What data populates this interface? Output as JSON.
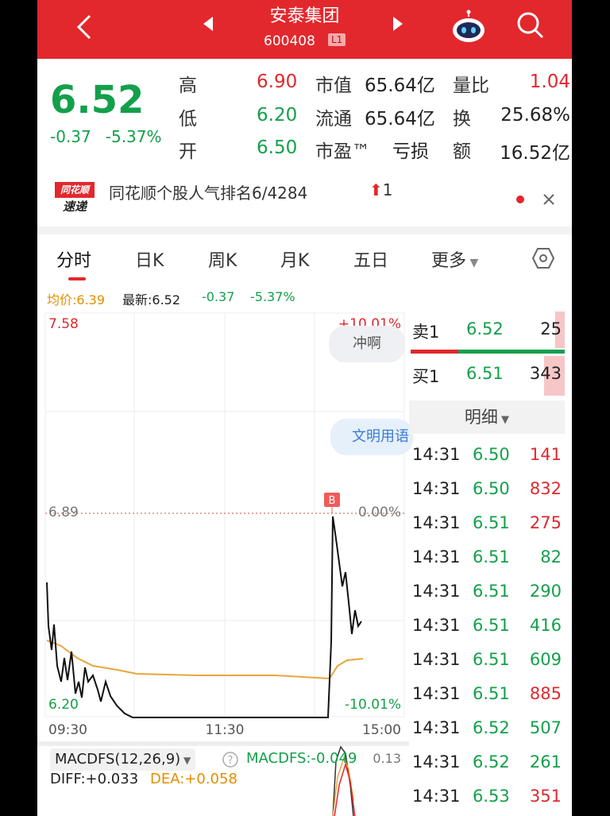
{
  "header": {
    "title": "安泰集团",
    "code": "600408",
    "level_badge": "L1",
    "colors": {
      "bar": "#e2282d"
    }
  },
  "quote": {
    "price": "6.52",
    "change": "-0.37",
    "change_pct": "-5.37%",
    "rows": [
      {
        "l1": "高",
        "v1": "6.90",
        "l2": "市值",
        "v2": "65.64亿",
        "l3": "量比",
        "v3": "1.04"
      },
      {
        "l1": "低",
        "v1": "6.20",
        "l2": "流通",
        "v2": "65.64亿",
        "l3": "换",
        "v3": "25.68%"
      },
      {
        "l1": "开",
        "v1": "6.50",
        "l2": "市盈™",
        "v2": "亏损",
        "l3": "额",
        "v3": "16.52亿"
      }
    ]
  },
  "news": {
    "logo_top": "同花顺",
    "logo_bottom": "速递",
    "text": "同花顺个股人气排名6/4284",
    "rank_change": "1"
  },
  "tabs": [
    "分时",
    "日K",
    "周K",
    "月K",
    "五日",
    "更多"
  ],
  "info": {
    "avg_label": "均价:6.39",
    "latest_label": "最新:6.52",
    "change": "-0.37",
    "change_pct": "-5.37%"
  },
  "chart": {
    "top_price": "7.58",
    "mid_price": "6.89",
    "bottom_price": "6.20",
    "top_pct": "+10.01%",
    "mid_pct": "0.00%",
    "bottom_pct": "-10.01%",
    "time_labels": [
      "09:30",
      "11:30",
      "15:00"
    ],
    "marker": "B",
    "pill_1": "冲啊",
    "pill_2": "文明用语"
  },
  "order_book": {
    "sell": {
      "label": "卖1",
      "price": "6.52",
      "volume": "25"
    },
    "buy": {
      "label": "买1",
      "price": "6.51",
      "volume": "343"
    },
    "detail_label": "明细"
  },
  "ticks": [
    {
      "time": "14:31",
      "price": "6.50",
      "vol": "141",
      "side": "red"
    },
    {
      "time": "14:31",
      "price": "6.50",
      "vol": "832",
      "side": "red"
    },
    {
      "time": "14:31",
      "price": "6.51",
      "vol": "275",
      "side": "red"
    },
    {
      "time": "14:31",
      "price": "6.51",
      "vol": "82",
      "side": "green"
    },
    {
      "time": "14:31",
      "price": "6.51",
      "vol": "290",
      "side": "green"
    },
    {
      "time": "14:31",
      "price": "6.51",
      "vol": "416",
      "side": "green"
    },
    {
      "time": "14:31",
      "price": "6.51",
      "vol": "609",
      "side": "green"
    },
    {
      "time": "14:31",
      "price": "6.51",
      "vol": "885",
      "side": "red"
    },
    {
      "time": "14:31",
      "price": "6.52",
      "vol": "507",
      "side": "green"
    },
    {
      "time": "14:31",
      "price": "6.52",
      "vol": "261",
      "side": "green"
    },
    {
      "time": "14:31",
      "price": "6.53",
      "vol": "351",
      "side": "red"
    }
  ],
  "macd": {
    "selector": "MACDFS(12,26,9)",
    "value": "MACDFS:-0.049",
    "diff": "DIFF:+0.033",
    "dea": "DEA:+0.058",
    "axis_value": "0.13"
  }
}
